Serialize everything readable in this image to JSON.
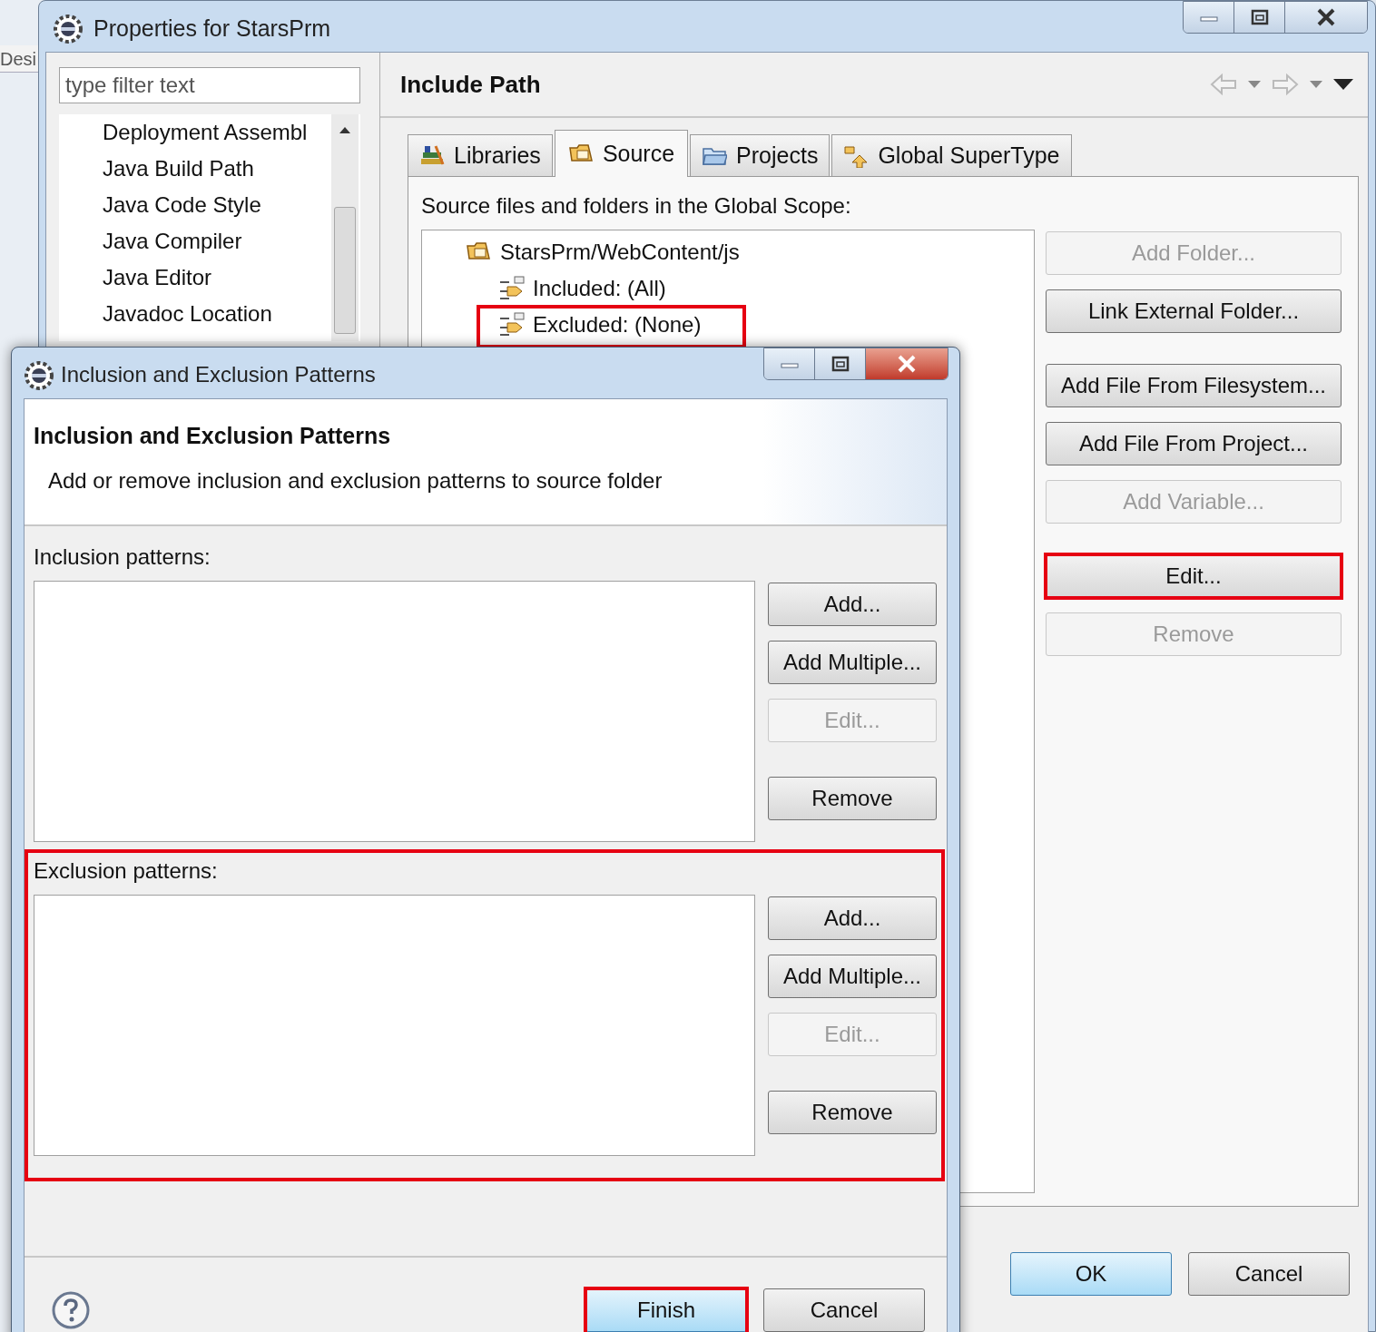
{
  "background_window": {
    "tab_label": "Desi"
  },
  "properties_window": {
    "title": "Properties for StarsPrm",
    "filter": {
      "placeholder": "type filter text"
    },
    "tree_items": [
      {
        "label": "Deployment Assembl"
      },
      {
        "label": "Java Build Path"
      },
      {
        "label": "Java Code Style"
      },
      {
        "label": "Java Compiler"
      },
      {
        "label": "Java Editor"
      },
      {
        "label": "Javadoc Location"
      }
    ],
    "page_title": "Include Path",
    "tabs": [
      {
        "label": "Libraries",
        "selected": false
      },
      {
        "label": "Source",
        "selected": true
      },
      {
        "label": "Projects",
        "selected": false
      },
      {
        "label": "Global SuperType",
        "selected": false
      }
    ],
    "scope_label": "Source files and folders in the Global Scope:",
    "source_tree": [
      {
        "label": "StarsPrm/WebContent/js",
        "highlighted": false,
        "children": [
          {
            "label": "Included: (All)",
            "highlighted": false
          },
          {
            "label": "Excluded: (None)",
            "highlighted": true
          }
        ]
      }
    ],
    "button_groups": [
      [
        {
          "label": "Add Folder...",
          "disabled": true,
          "highlighted": false
        },
        {
          "label": "Link External Folder...",
          "disabled": false,
          "highlighted": false
        }
      ],
      [
        {
          "label": "Add File From Filesystem...",
          "disabled": false,
          "highlighted": false
        },
        {
          "label": "Add File From Project...",
          "disabled": false,
          "highlighted": false
        },
        {
          "label": "Add Variable...",
          "disabled": true,
          "highlighted": false
        }
      ],
      [
        {
          "label": "Edit...",
          "disabled": false,
          "highlighted": true
        },
        {
          "label": "Remove",
          "disabled": true,
          "highlighted": false
        }
      ]
    ],
    "footer_buttons": [
      {
        "label": "OK",
        "default": true
      },
      {
        "label": "Cancel",
        "default": false
      }
    ]
  },
  "patterns_dialog": {
    "title": "Inclusion and Exclusion Patterns",
    "heading": "Inclusion and Exclusion Patterns",
    "description": "Add or remove inclusion and exclusion patterns to source folder",
    "sections": [
      {
        "label": "Inclusion patterns:",
        "highlighted": false,
        "buttons": [
          {
            "label": "Add...",
            "disabled": false
          },
          {
            "label": "Add Multiple...",
            "disabled": false
          },
          {
            "label": "Edit...",
            "disabled": true
          },
          {
            "label": "Remove",
            "disabled": false
          }
        ]
      },
      {
        "label": "Exclusion patterns:",
        "highlighted": true,
        "buttons": [
          {
            "label": "Add...",
            "disabled": false
          },
          {
            "label": "Add Multiple...",
            "disabled": false
          },
          {
            "label": "Edit...",
            "disabled": true
          },
          {
            "label": "Remove",
            "disabled": false
          }
        ]
      }
    ],
    "footer_buttons": [
      {
        "label": "Finish",
        "default": true,
        "highlighted": true
      },
      {
        "label": "Cancel",
        "default": false,
        "highlighted": false
      }
    ]
  }
}
